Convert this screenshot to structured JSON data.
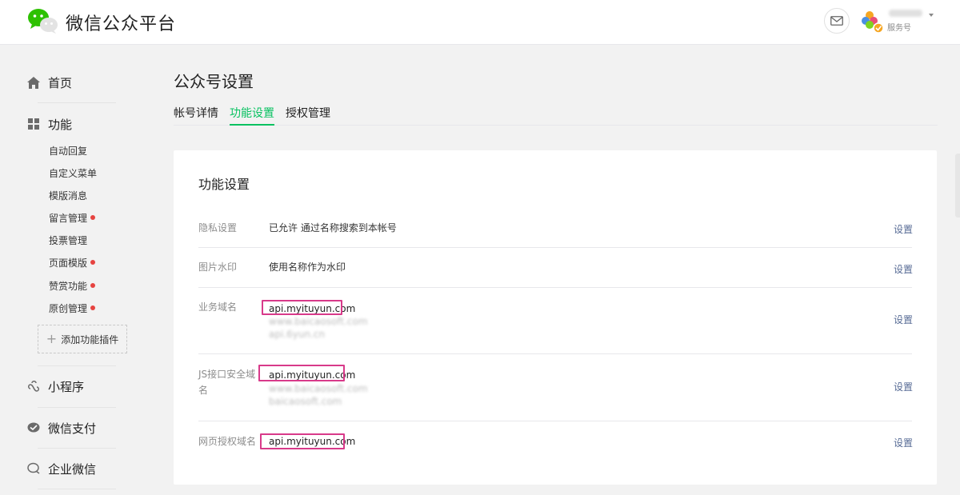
{
  "header": {
    "brand": "微信公众平台",
    "account_name": "",
    "account_type": "服务号"
  },
  "sidebar": {
    "sections": [
      {
        "label": "首页",
        "icon": "home-icon"
      },
      {
        "label": "功能",
        "icon": "grid-icon"
      },
      {
        "label": "小程序",
        "icon": "mini-program-icon"
      },
      {
        "label": "微信支付",
        "icon": "wechat-pay-icon"
      },
      {
        "label": "企业微信",
        "icon": "enterprise-wechat-icon"
      }
    ],
    "feature_items": [
      {
        "label": "自动回复",
        "dot": false
      },
      {
        "label": "自定义菜单",
        "dot": false
      },
      {
        "label": "模版消息",
        "dot": false
      },
      {
        "label": "留言管理",
        "dot": true
      },
      {
        "label": "投票管理",
        "dot": false
      },
      {
        "label": "页面模版",
        "dot": true
      },
      {
        "label": "赞赏功能",
        "dot": true
      },
      {
        "label": "原创管理",
        "dot": true
      }
    ],
    "add_plugin": "添加功能插件"
  },
  "main": {
    "page_title": "公众号设置",
    "tabs": [
      {
        "label": "帐号详情",
        "active": false
      },
      {
        "label": "功能设置",
        "active": true
      },
      {
        "label": "授权管理",
        "active": false
      }
    ],
    "panel_title": "功能设置",
    "rows": [
      {
        "label": "隐私设置",
        "value": "已允许 通过名称搜索到本帐号",
        "action": "设置"
      },
      {
        "label": "图片水印",
        "value": "使用名称作为水印",
        "action": "设置"
      },
      {
        "label": "业务域名",
        "domains": [
          "api.myituyun.com",
          "www.baicaosoft.com",
          "api.6yun.cn"
        ],
        "action": "设置"
      },
      {
        "label": "JS接口安全域名",
        "domains": [
          "api.myituyun.com",
          "www.baicaosoft.com",
          "baicaosoft.com"
        ],
        "action": "设置"
      },
      {
        "label": "网页授权域名",
        "domains": [
          "api.myituyun.com"
        ],
        "action": "设置"
      }
    ]
  },
  "colors": {
    "accent": "#07c160",
    "link": "#576b95",
    "highlight": "#d83a8a",
    "dot": "#e64340"
  }
}
